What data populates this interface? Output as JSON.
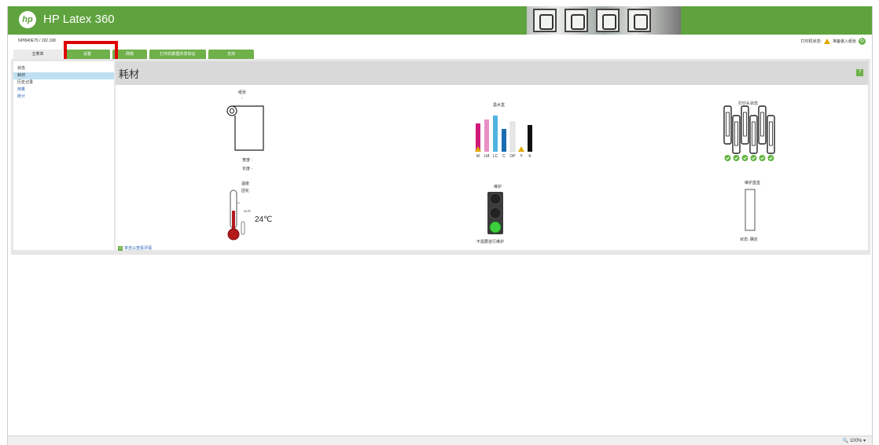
{
  "header": {
    "logo_text": "hp",
    "title": "HP Latex 360"
  },
  "subheader": {
    "device_id": "NPI840E75 / 192.168",
    "printer_status_label": "打印机状态:",
    "printer_status_value": "准备装入纸张"
  },
  "tabs": [
    {
      "label": "主菜单"
    },
    {
      "label": "设置"
    },
    {
      "label": "网络"
    },
    {
      "label": "打印机数据共享协议"
    },
    {
      "label": "支持"
    }
  ],
  "sidebar": {
    "items": [
      {
        "label": "状态"
      },
      {
        "label": "耗材"
      },
      {
        "label": "历史记录"
      },
      {
        "label": "用量"
      },
      {
        "label": "统计"
      }
    ]
  },
  "main": {
    "title": "耗材",
    "help_icon": "?",
    "paper": {
      "title": "纸张",
      "value": "-",
      "width_label": "宽度 -",
      "length_label": "长度 -"
    },
    "ink": {
      "title": "墨水盒",
      "colors": [
        "M",
        "LM",
        "LC",
        "C",
        "OP",
        "Y",
        "K"
      ],
      "levels": [
        0.75,
        0.85,
        0.95,
        0.6,
        0.8,
        0.0,
        0.7
      ],
      "bar_colors": [
        "#d1197a",
        "#e88fc3",
        "#4fb4e3",
        "#1b6db2",
        "#e8e8e8",
        "#f2e500",
        "#111111"
      ],
      "warnings": [
        true,
        false,
        false,
        false,
        false,
        true,
        false
      ]
    },
    "printheads": {
      "title": "打印头状态",
      "count": 6
    },
    "temperature": {
      "title": "温度",
      "subtitle": "固化",
      "max": "25℃",
      "value": "24℃"
    },
    "maintenance": {
      "title": "维护",
      "status": "不需要进行维护"
    },
    "cartridge": {
      "title": "维护墨盒",
      "status": "状态: 确定"
    },
    "feedback_link": "单击以查看评语"
  },
  "statusbar": {
    "zoom": "100%"
  }
}
